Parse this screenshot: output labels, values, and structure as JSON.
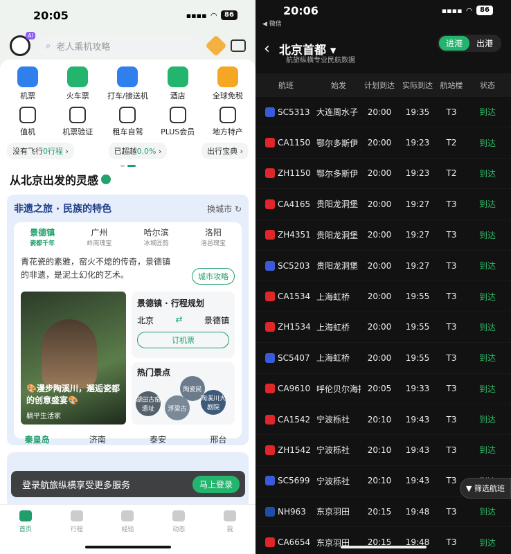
{
  "left": {
    "status": {
      "time": "20:05",
      "battery": "86"
    },
    "search": {
      "placeholder": "老人乘机攻略"
    },
    "grid": [
      {
        "label": "机票",
        "icon": "plane-icon",
        "color": "#2f80ed"
      },
      {
        "label": "火车票",
        "icon": "train-icon",
        "color": "#23b46d"
      },
      {
        "label": "打车/接送机",
        "icon": "car-icon",
        "color": "#2f80ed"
      },
      {
        "label": "酒店",
        "icon": "hotel-icon",
        "color": "#23b46d"
      },
      {
        "label": "全球免税",
        "icon": "dutyfree-icon",
        "color": "#f5a623"
      },
      {
        "label": "值机",
        "icon": "checkin-icon"
      },
      {
        "label": "机票验证",
        "icon": "verify-icon"
      },
      {
        "label": "租车自驾",
        "icon": "rental-icon"
      },
      {
        "label": "PLUS会员",
        "icon": "member-icon"
      },
      {
        "label": "地方特产",
        "icon": "specialty-icon"
      }
    ],
    "chips": {
      "no_flight_prefix": "没有飞行",
      "no_flight_value": "0行程",
      "exceeded_prefix": "已超越",
      "exceeded_value": "0.0%",
      "treasure": "出行宝典"
    },
    "section_title": "从北京出发的灵感",
    "card": {
      "title": "非遗之旅 · 民族的特色",
      "switch_city": "换城市",
      "tabs": [
        {
          "city": "景德镇",
          "sub": "瓷都千年"
        },
        {
          "city": "广州",
          "sub": "岭南瑰宝"
        },
        {
          "city": "哈尔滨",
          "sub": "冰城匠韵"
        },
        {
          "city": "洛阳",
          "sub": "洛邑瑰宝"
        }
      ],
      "desc": "青花瓷的素雅，窑火不熄的传奇，景德镇的非遗，是泥土幻化的艺术。",
      "city_guide": "城市攻略",
      "poster_caption": "🎨漫步陶溪川，邂逅瓷都的创意盛宴🎨",
      "poster_author": "躺平生活家",
      "plan_title": "景德镇 · 行程规划",
      "plan_from": "北京",
      "plan_to": "景德镇",
      "plan_button": "订机票",
      "spots_title": "热门景点",
      "spots": [
        "陶瓷民",
        "湖田古窑遗址",
        "浮梁古",
        "陶溪川大剧院"
      ]
    },
    "tabs2": [
      "秦皇岛",
      "济南",
      "泰安",
      "邢台"
    ],
    "toast": {
      "text": "登录航旅纵横享受更多服务",
      "button": "马上登录"
    },
    "nav": [
      "首页",
      "行程",
      "经验",
      "动态",
      "我"
    ]
  },
  "right": {
    "status": {
      "time": "20:06",
      "battery": "86",
      "back_app": "◀ 微信"
    },
    "title": "北京首都",
    "subtitle": "航旅纵横专业民航数据",
    "toggle": {
      "arrive": "进港",
      "depart": "出港"
    },
    "headers": [
      "航班",
      "始发",
      "计划到达",
      "实际到达",
      "航站楼",
      "状态"
    ],
    "flights": [
      {
        "no": "SC5313",
        "from": "大连周水子",
        "plan": "20:00",
        "actual": "19:35",
        "term": "T3",
        "status": "到达",
        "color": "#3a5bd9"
      },
      {
        "no": "CA1150",
        "from": "鄂尔多斯伊",
        "plan": "20:00",
        "actual": "19:23",
        "term": "T2",
        "status": "到达",
        "color": "#e0262b"
      },
      {
        "no": "ZH1150",
        "from": "鄂尔多斯伊",
        "plan": "20:00",
        "actual": "19:23",
        "term": "T2",
        "status": "到达",
        "color": "#e0262b"
      },
      {
        "no": "CA4165",
        "from": "贵阳龙洞堡",
        "plan": "20:00",
        "actual": "19:27",
        "term": "T3",
        "status": "到达",
        "color": "#e0262b"
      },
      {
        "no": "ZH4351",
        "from": "贵阳龙洞堡",
        "plan": "20:00",
        "actual": "19:27",
        "term": "T3",
        "status": "到达",
        "color": "#e0262b"
      },
      {
        "no": "SC5203",
        "from": "贵阳龙洞堡",
        "plan": "20:00",
        "actual": "19:27",
        "term": "T3",
        "status": "到达",
        "color": "#3a5bd9"
      },
      {
        "no": "CA1534",
        "from": "上海虹桥",
        "plan": "20:00",
        "actual": "19:55",
        "term": "T3",
        "status": "到达",
        "color": "#e0262b"
      },
      {
        "no": "ZH1534",
        "from": "上海虹桥",
        "plan": "20:00",
        "actual": "19:55",
        "term": "T3",
        "status": "到达",
        "color": "#e0262b"
      },
      {
        "no": "SC5407",
        "from": "上海虹桥",
        "plan": "20:00",
        "actual": "19:55",
        "term": "T3",
        "status": "到达",
        "color": "#3a5bd9"
      },
      {
        "no": "CA9610",
        "from": "呼伦贝尔海拉尔",
        "plan": "20:05",
        "actual": "19:33",
        "term": "T3",
        "status": "到达",
        "color": "#e0262b"
      },
      {
        "no": "CA1542",
        "from": "宁波栎社",
        "plan": "20:10",
        "actual": "19:43",
        "term": "T3",
        "status": "到达",
        "color": "#e0262b"
      },
      {
        "no": "ZH1542",
        "from": "宁波栎社",
        "plan": "20:10",
        "actual": "19:43",
        "term": "T3",
        "status": "到达",
        "color": "#e0262b"
      },
      {
        "no": "SC5699",
        "from": "宁波栎社",
        "plan": "20:10",
        "actual": "19:43",
        "term": "T3",
        "status": "到达",
        "color": "#3a5bd9"
      },
      {
        "no": "NH963",
        "from": "东京羽田",
        "plan": "20:15",
        "actual": "19:48",
        "term": "T3",
        "status": "到达",
        "color": "#1d4fa8"
      },
      {
        "no": "CA6654",
        "from": "东京羽田",
        "plan": "20:15",
        "actual": "19:48",
        "term": "T3",
        "status": "到达",
        "color": "#e0262b"
      }
    ],
    "filter": "筛选航班"
  }
}
